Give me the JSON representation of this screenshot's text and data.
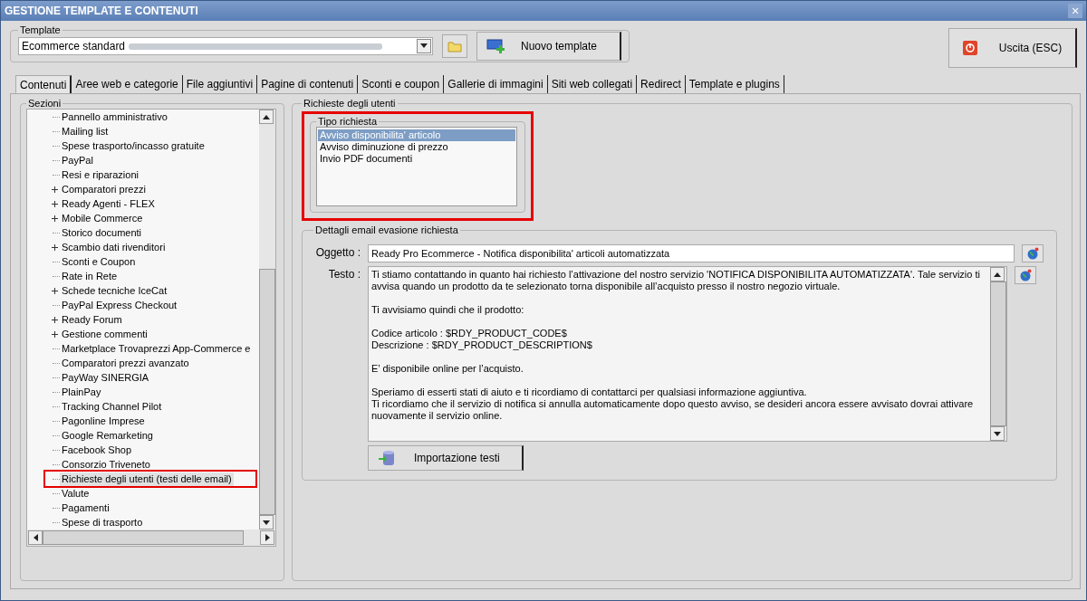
{
  "window": {
    "title": "GESTIONE TEMPLATE E CONTENUTI",
    "close": "✕"
  },
  "template": {
    "legend": "Template",
    "value": "Ecommerce standard",
    "new_button": "Nuovo template"
  },
  "exit_button": "Uscita (ESC)",
  "tabs": [
    {
      "label": "Contenuti",
      "selected": true
    },
    {
      "label": "Aree web e categorie",
      "selected": false
    },
    {
      "label": "File aggiuntivi",
      "selected": false
    },
    {
      "label": "Pagine di contenuti",
      "selected": false
    },
    {
      "label": "Sconti e coupon",
      "selected": false
    },
    {
      "label": "Gallerie di immagini",
      "selected": false
    },
    {
      "label": "Siti web collegati",
      "selected": false
    },
    {
      "label": "Redirect",
      "selected": false
    },
    {
      "label": "Template e plugins",
      "selected": false
    }
  ],
  "sections": {
    "legend": "Sezioni",
    "items": [
      {
        "label": "Pannello amministrativo",
        "expandable": false,
        "selected": false
      },
      {
        "label": "Mailing list",
        "expandable": false,
        "selected": false
      },
      {
        "label": "Spese trasporto/incasso gratuite",
        "expandable": false,
        "selected": false
      },
      {
        "label": "PayPal",
        "expandable": false,
        "selected": false
      },
      {
        "label": "Resi e riparazioni",
        "expandable": false,
        "selected": false
      },
      {
        "label": "Comparatori prezzi",
        "expandable": true,
        "selected": false
      },
      {
        "label": "Ready Agenti - FLEX",
        "expandable": true,
        "selected": false
      },
      {
        "label": "Mobile Commerce",
        "expandable": true,
        "selected": false
      },
      {
        "label": "Storico documenti",
        "expandable": false,
        "selected": false
      },
      {
        "label": "Scambio dati rivenditori",
        "expandable": true,
        "selected": false
      },
      {
        "label": "Sconti e Coupon",
        "expandable": false,
        "selected": false
      },
      {
        "label": "Rate in Rete",
        "expandable": false,
        "selected": false
      },
      {
        "label": "Schede tecniche IceCat",
        "expandable": true,
        "selected": false
      },
      {
        "label": "PayPal Express Checkout",
        "expandable": false,
        "selected": false
      },
      {
        "label": "Ready Forum",
        "expandable": true,
        "selected": false
      },
      {
        "label": "Gestione commenti",
        "expandable": true,
        "selected": false
      },
      {
        "label": "Marketplace Trovaprezzi App-Commerce e",
        "expandable": false,
        "selected": false
      },
      {
        "label": "Comparatori prezzi avanzato",
        "expandable": false,
        "selected": false
      },
      {
        "label": "PayWay SINERGIA",
        "expandable": false,
        "selected": false
      },
      {
        "label": "PlainPay",
        "expandable": false,
        "selected": false
      },
      {
        "label": "Tracking Channel Pilot",
        "expandable": false,
        "selected": false
      },
      {
        "label": "Pagonline Imprese",
        "expandable": false,
        "selected": false
      },
      {
        "label": "Google Remarketing",
        "expandable": false,
        "selected": false
      },
      {
        "label": "Facebook Shop",
        "expandable": false,
        "selected": false
      },
      {
        "label": "Consorzio Triveneto",
        "expandable": false,
        "selected": false
      },
      {
        "label": "Richieste degli utenti (testi delle email)",
        "expandable": false,
        "selected": true
      },
      {
        "label": "Valute",
        "expandable": false,
        "selected": false
      },
      {
        "label": "Pagamenti",
        "expandable": false,
        "selected": false
      },
      {
        "label": "Spese di trasporto",
        "expandable": false,
        "selected": false
      }
    ]
  },
  "requests": {
    "legend": "Richieste degli utenti",
    "type_legend": "Tipo richiesta",
    "types": [
      {
        "label": "Avviso disponibilita' articolo",
        "selected": true
      },
      {
        "label": "Avviso diminuzione di prezzo",
        "selected": false
      },
      {
        "label": "Invio PDF documenti",
        "selected": false
      }
    ]
  },
  "email": {
    "legend": "Dettagli email evasione richiesta",
    "subject_label": "Oggetto :",
    "subject": "Ready Pro Ecommerce - Notifica disponibilita' articoli automatizzata",
    "body_label": "Testo :",
    "body": [
      [
        "Ti stiamo contattando in quanto hai richiesto l’attivazione del nostro servizio 'NOTIFICA DISPONIBILITA AUTOMATIZZATA'. Tale servizio ti avvisa quando un prodotto da te selezionato torna disponibile all’acquisto presso il nostro negozio virtuale."
      ],
      [
        "Ti avvisiamo quindi che il prodotto:"
      ],
      [
        "Codice articolo : $RDY_PRODUCT_CODE$",
        "Descrizione : $RDY_PRODUCT_DESCRIPTION$"
      ],
      [
        "E’ disponibile online per l’acquisto."
      ],
      [
        "Speriamo di esserti stati di aiuto e ti ricordiamo di contattarci per qualsiasi informazione aggiuntiva.",
        "Ti ricordiamo che il servizio di notifica si annulla automaticamente dopo questo avviso, se desideri ancora essere avvisato dovrai attivare nuovamente il servizio online."
      ]
    ],
    "import_button": "Importazione testi"
  }
}
